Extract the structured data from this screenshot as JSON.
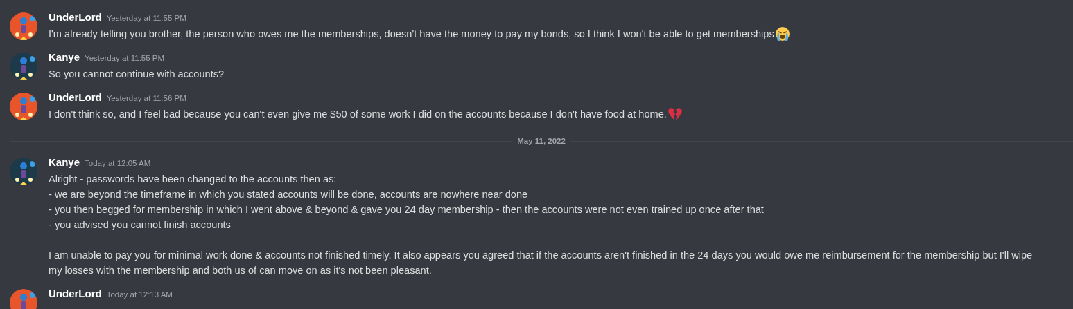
{
  "messages": [
    {
      "kind": "message",
      "author": "UnderLord",
      "avatar": {
        "kind": "picture",
        "color": "#e8552a"
      },
      "time": "Yesterday at 11:55 PM",
      "paragraphs": [
        {
          "kind": "crying",
          "text": "I'm already telling you brother, the person who owes me the memberships, doesn't have the money to pay my bonds, so I think I won't be able to get memberships"
        }
      ]
    },
    {
      "kind": "message",
      "author": "Kanye",
      "avatar": {
        "kind": "picture",
        "color": "#1d3a4a"
      },
      "time": "Yesterday at 11:55 PM",
      "paragraphs": [
        {
          "kind": "plain",
          "text": "So you cannot continue with accounts?"
        }
      ]
    },
    {
      "kind": "message",
      "author": "UnderLord",
      "avatar": {
        "kind": "picture",
        "color": "#e8552a"
      },
      "time": "Yesterday at 11:56 PM",
      "paragraphs": [
        {
          "kind": "heartbreak",
          "text": "I don't think so, and I feel bad because you can't even give me $50 of some work I did on the accounts because I don't have food at home."
        }
      ]
    },
    {
      "kind": "divider",
      "label": "May 11, 2022"
    },
    {
      "kind": "message",
      "author": "Kanye",
      "avatar": {
        "kind": "picture",
        "color": "#1d3a4a"
      },
      "time": "Today at 12:05 AM",
      "paragraphs": [
        {
          "kind": "plain",
          "text": "Alright - passwords have been changed to the accounts then as:\n- we are beyond the timeframe in which you stated accounts will be done, accounts are nowhere near done\n- you then begged for membership in which I went above & beyond & gave you 24 day membership - then the accounts were not even trained up once after that\n- you advised you cannot finish accounts"
        },
        {
          "kind": "plain",
          "text": "I am unable to pay you for minimal work done & accounts not finished timely. It also appears you agreed that if the accounts aren't finished in the 24 days you would owe me reimbursement for the membership but I'll wipe\nmy losses with the membership and both us of can move on as it's not been pleasant."
        }
      ]
    },
    {
      "kind": "message",
      "author": "UnderLord",
      "avatar": {
        "kind": "picture",
        "color": "#e8552a"
      },
      "time": "Today at 12:13 AM"
    }
  ]
}
